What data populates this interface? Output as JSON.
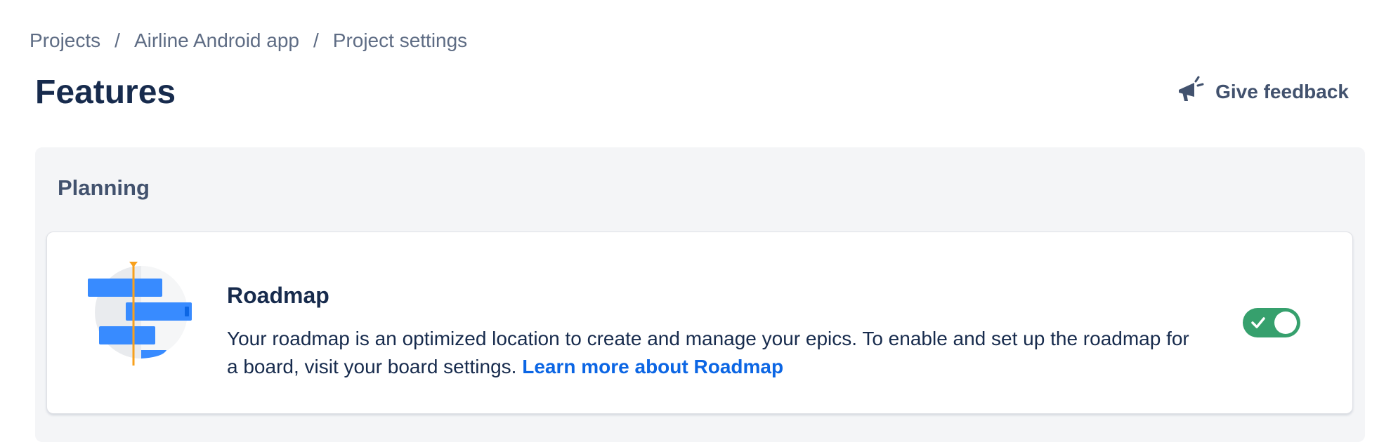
{
  "breadcrumb": {
    "items": [
      "Projects",
      "Airline Android app",
      "Project settings"
    ],
    "separator": "/"
  },
  "page": {
    "title": "Features"
  },
  "feedback": {
    "label": "Give feedback",
    "icon": "megaphone-icon"
  },
  "sections": [
    {
      "title": "Planning",
      "features": [
        {
          "title": "Roadmap",
          "description": "Your roadmap is an optimized location to create and manage your epics. To enable and set up the roadmap for a board, visit your board settings.",
          "link": "Learn more about Roadmap",
          "enabled": true,
          "icon": "roadmap-illustration"
        }
      ]
    }
  ],
  "colors": {
    "link": "#0c66e4",
    "toggle_on": "#36a06d",
    "heading": "#172b4d",
    "muted": "#5e6c84"
  }
}
